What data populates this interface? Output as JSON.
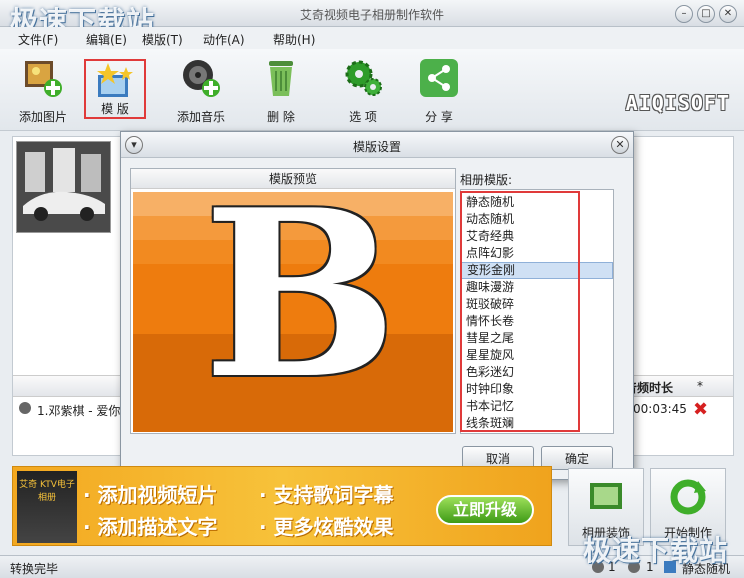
{
  "window": {
    "title": "艾奇视频电子相册制作软件",
    "watermark": "极速下载站"
  },
  "menu": [
    "文件(F)",
    "编辑(E)",
    "模版(T)",
    "动作(A)",
    "帮助(H)"
  ],
  "toolbar": {
    "items": [
      {
        "label": "添加图片",
        "icon": "add-photo-icon"
      },
      {
        "label": "模 版",
        "icon": "template-icon"
      },
      {
        "label": "添加音乐",
        "icon": "add-music-icon"
      },
      {
        "label": "删 除",
        "icon": "trash-icon"
      },
      {
        "label": "选 项",
        "icon": "gear-icon"
      },
      {
        "label": "分 享",
        "icon": "share-icon"
      }
    ],
    "brand": "AIQISOFT"
  },
  "music_list": {
    "col_duration": "音频时长",
    "col_star": "*",
    "row": {
      "name": "1.邓紫棋 - 爱你",
      "duration": "00:03:45"
    }
  },
  "dialog": {
    "title": "模版设置",
    "preview_label": "模版预览",
    "preview_letter": "B",
    "templates_label": "相册模版:",
    "templates": [
      "静态随机",
      "动态随机",
      "艾奇经典",
      "点阵幻影",
      "变形金刚",
      "趣味漫游",
      "斑驳破碎",
      "情怀长卷",
      "彗星之尾",
      "星星旋风",
      "色彩迷幻",
      "时钟印象",
      "书本记忆",
      "线条斑斓"
    ],
    "selected_index": 4,
    "cancel": "取消",
    "ok": "确定"
  },
  "banner": {
    "box": "艾奇 KTV电子相册",
    "line1a": "· 添加视频短片",
    "line1b": "· 支持歌词字幕",
    "line2a": "· 添加描述文字",
    "line2b": "· 更多炫酷效果",
    "upgrade": "立即升级"
  },
  "bottom_buttons": {
    "decorate": "相册装饰",
    "start": "开始制作"
  },
  "status": {
    "text": "转换完毕",
    "count1": "1",
    "count2": "1",
    "mode": "静态随机"
  }
}
